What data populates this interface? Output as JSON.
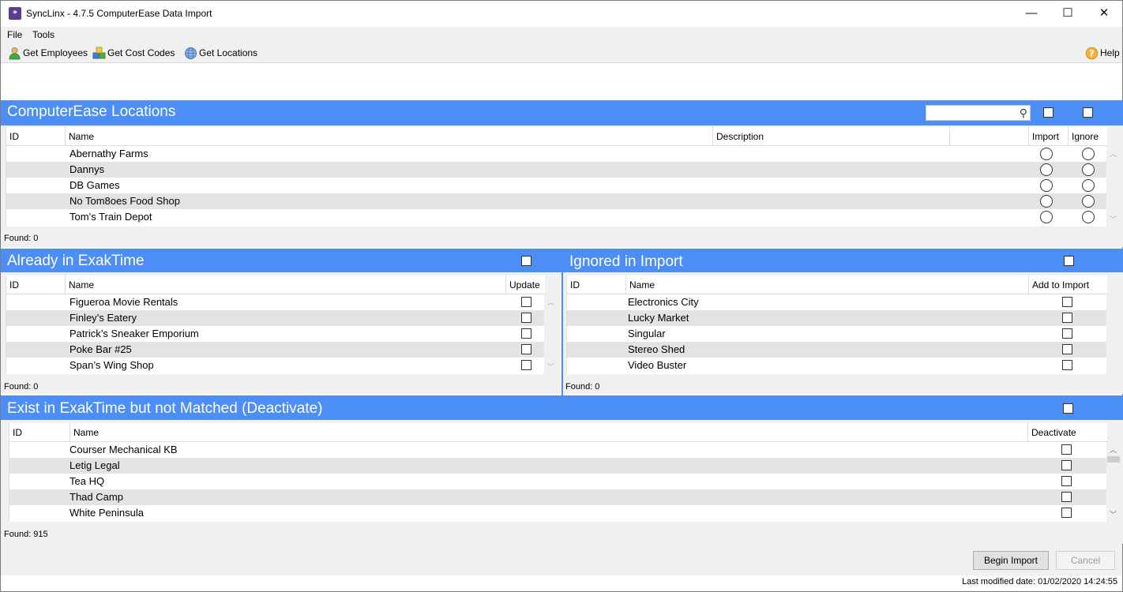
{
  "window": {
    "title": "SyncLinx - 4.7.5  ComputerEase Data Import",
    "minimize": "—",
    "maximize": "☐",
    "close": "✕"
  },
  "menu": {
    "file": "File",
    "tools": "Tools"
  },
  "toolbar": {
    "get_employees": "Get Employees",
    "get_cost_codes": "Get Cost Codes",
    "get_locations": "Get Locations",
    "help": "Help"
  },
  "locations": {
    "title": "ComputerEase Locations",
    "search_placeholder": "",
    "columns": {
      "id": "ID",
      "name": "Name",
      "description": "Description",
      "import": "Import",
      "ignore": "Ignore"
    },
    "rows": [
      {
        "id": "",
        "name": "Abernathy Farms",
        "description": ""
      },
      {
        "id": "",
        "name": "Dannys",
        "description": ""
      },
      {
        "id": "",
        "name": "DB Games",
        "description": ""
      },
      {
        "id": "",
        "name": "No Tom8oes Food Shop",
        "description": ""
      },
      {
        "id": "",
        "name": "Tom’s Train Depot",
        "description": ""
      }
    ],
    "found": "Found: 0"
  },
  "already": {
    "title": "Already in ExakTime",
    "columns": {
      "id": "ID",
      "name": "Name",
      "update": "Update"
    },
    "rows": [
      {
        "id": "",
        "name": "Figueroa Movie Rentals"
      },
      {
        "id": "",
        "name": "Finley’s Eatery"
      },
      {
        "id": "",
        "name": "Patrick’s Sneaker Emporium"
      },
      {
        "id": "",
        "name": "Poke Bar #25"
      },
      {
        "id": "",
        "name": "Span’s Wing Shop"
      }
    ],
    "found": "Found: 0"
  },
  "ignored": {
    "title": "Ignored in Import",
    "columns": {
      "id": "ID",
      "name": "Name",
      "add": "Add to Import"
    },
    "rows": [
      {
        "id": "",
        "name": "Electronics City"
      },
      {
        "id": "",
        "name": "Lucky Market"
      },
      {
        "id": "",
        "name": "Singular"
      },
      {
        "id": "",
        "name": "Stereo Shed"
      },
      {
        "id": "",
        "name": "Video Buster"
      }
    ],
    "found": "Found: 0"
  },
  "deactivate": {
    "title": "Exist in ExakTime but not Matched (Deactivate)",
    "columns": {
      "id": "ID",
      "name": "Name",
      "deactivate": "Deactivate"
    },
    "rows": [
      {
        "id": "",
        "name": "Courser Mechanical KB"
      },
      {
        "id": "",
        "name": "Letig Legal"
      },
      {
        "id": "",
        "name": "Tea HQ"
      },
      {
        "id": "",
        "name": "Thad Camp"
      },
      {
        "id": "",
        "name": "White Peninsula"
      }
    ],
    "found": "Found: 915"
  },
  "footer": {
    "begin_import": "Begin Import",
    "cancel": "Cancel",
    "last_modified": "Last modified date: 01/02/2020 14:24:55"
  },
  "colors": {
    "section_header": "#4c8ef5",
    "alt_row": "#e3e3e3",
    "chrome": "#f0f0f0"
  }
}
